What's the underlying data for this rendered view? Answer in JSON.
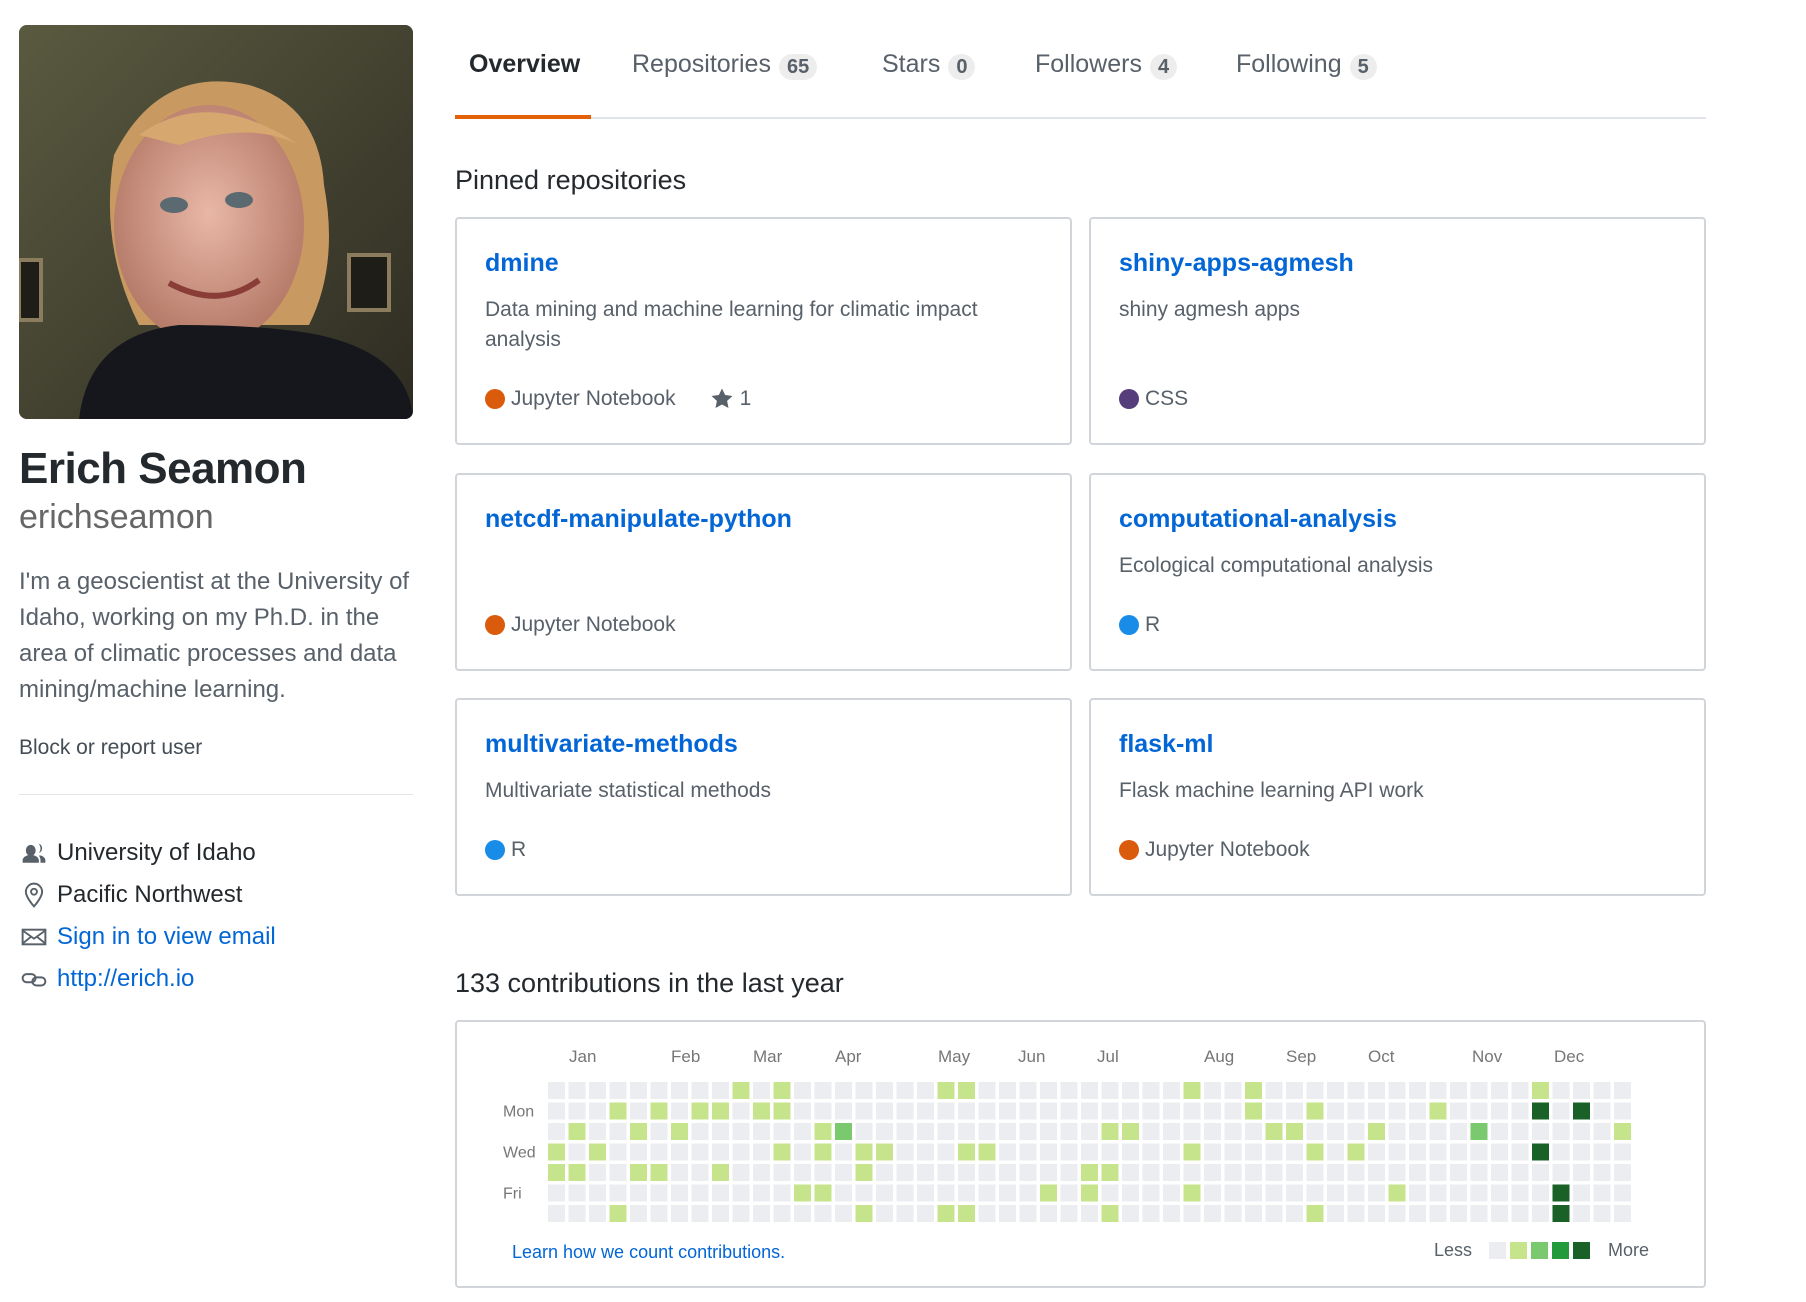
{
  "profile": {
    "full_name": "Erich Seamon",
    "username": "erichseamon",
    "bio": "I'm a geoscientist at the University of Idaho, working on my Ph.D. in the area of climatic processes and data mining/machine learning.",
    "block_label": "Block or report user",
    "details": [
      {
        "icon": "people-icon",
        "text": "University of Idaho",
        "link": false
      },
      {
        "icon": "location-icon",
        "text": "Pacific Northwest",
        "link": false
      },
      {
        "icon": "mail-icon",
        "text": "Sign in to view email",
        "link": true
      },
      {
        "icon": "link-icon",
        "text": "http://erich.io",
        "link": true
      }
    ]
  },
  "tabs": [
    {
      "label": "Overview",
      "count": null,
      "active": true
    },
    {
      "label": "Repositories",
      "count": "65",
      "active": false
    },
    {
      "label": "Stars",
      "count": "0",
      "active": false
    },
    {
      "label": "Followers",
      "count": "4",
      "active": false
    },
    {
      "label": "Following",
      "count": "5",
      "active": false
    }
  ],
  "pinned": {
    "title": "Pinned repositories",
    "repos": [
      {
        "name": "dmine",
        "description": "Data mining and machine learning for climatic impact analysis",
        "language": "Jupyter Notebook",
        "lang_color": "#DA5B0B",
        "stars": "1"
      },
      {
        "name": "shiny-apps-agmesh",
        "description": "shiny agmesh apps",
        "language": "CSS",
        "lang_color": "#563d7c",
        "stars": null
      },
      {
        "name": "netcdf-manipulate-python",
        "description": "",
        "language": "Jupyter Notebook",
        "lang_color": "#DA5B0B",
        "stars": null
      },
      {
        "name": "computational-analysis",
        "description": "Ecological computational analysis",
        "language": "R",
        "lang_color": "#198CE7",
        "stars": null
      },
      {
        "name": "multivariate-methods",
        "description": "Multivariate statistical methods",
        "language": "R",
        "lang_color": "#198CE7",
        "stars": null
      },
      {
        "name": "flask-ml",
        "description": "Flask machine learning API work",
        "language": "Jupyter Notebook",
        "lang_color": "#DA5B0B",
        "stars": null
      }
    ]
  },
  "contributions": {
    "title": "133 contributions in the last year",
    "months": [
      "Jan",
      "Feb",
      "Mar",
      "Apr",
      "May",
      "Jun",
      "Jul",
      "Aug",
      "Sep",
      "Oct",
      "Nov",
      "Dec"
    ],
    "day_labels": [
      "Mon",
      "Wed",
      "Fri"
    ],
    "learn_link": "Learn how we count contributions.",
    "legend_less": "Less",
    "legend_more": "More",
    "level_colors": [
      "#ebedf0",
      "#c6e48b",
      "#7bc96f",
      "#239a3b",
      "#196127"
    ],
    "weeks": 53,
    "cells": [
      [
        9,
        0,
        1
      ],
      [
        11,
        0,
        1
      ],
      [
        19,
        0,
        1
      ],
      [
        20,
        0,
        1
      ],
      [
        31,
        0,
        1
      ],
      [
        34,
        0,
        1
      ],
      [
        48,
        0,
        1
      ],
      [
        3,
        1,
        1
      ],
      [
        5,
        1,
        1
      ],
      [
        7,
        1,
        1
      ],
      [
        8,
        1,
        1
      ],
      [
        10,
        1,
        1
      ],
      [
        11,
        1,
        1
      ],
      [
        34,
        1,
        1
      ],
      [
        37,
        1,
        1
      ],
      [
        43,
        1,
        1
      ],
      [
        48,
        1,
        4
      ],
      [
        50,
        1,
        4
      ],
      [
        1,
        2,
        1
      ],
      [
        4,
        2,
        1
      ],
      [
        6,
        2,
        1
      ],
      [
        13,
        2,
        1
      ],
      [
        14,
        2,
        2
      ],
      [
        27,
        2,
        1
      ],
      [
        28,
        2,
        1
      ],
      [
        35,
        2,
        1
      ],
      [
        36,
        2,
        1
      ],
      [
        40,
        2,
        1
      ],
      [
        45,
        2,
        2
      ],
      [
        52,
        2,
        1
      ],
      [
        0,
        3,
        1
      ],
      [
        2,
        3,
        1
      ],
      [
        11,
        3,
        1
      ],
      [
        13,
        3,
        1
      ],
      [
        15,
        3,
        1
      ],
      [
        16,
        3,
        1
      ],
      [
        20,
        3,
        1
      ],
      [
        21,
        3,
        1
      ],
      [
        31,
        3,
        1
      ],
      [
        37,
        3,
        1
      ],
      [
        39,
        3,
        1
      ],
      [
        48,
        3,
        4
      ],
      [
        0,
        4,
        1
      ],
      [
        1,
        4,
        1
      ],
      [
        4,
        4,
        1
      ],
      [
        5,
        4,
        1
      ],
      [
        8,
        4,
        1
      ],
      [
        15,
        4,
        1
      ],
      [
        26,
        4,
        1
      ],
      [
        27,
        4,
        1
      ],
      [
        12,
        5,
        1
      ],
      [
        13,
        5,
        1
      ],
      [
        24,
        5,
        1
      ],
      [
        26,
        5,
        1
      ],
      [
        31,
        5,
        1
      ],
      [
        41,
        5,
        1
      ],
      [
        49,
        5,
        4
      ],
      [
        3,
        6,
        1
      ],
      [
        15,
        6,
        1
      ],
      [
        19,
        6,
        1
      ],
      [
        20,
        6,
        1
      ],
      [
        27,
        6,
        1
      ],
      [
        37,
        6,
        1
      ],
      [
        49,
        6,
        4
      ]
    ]
  }
}
